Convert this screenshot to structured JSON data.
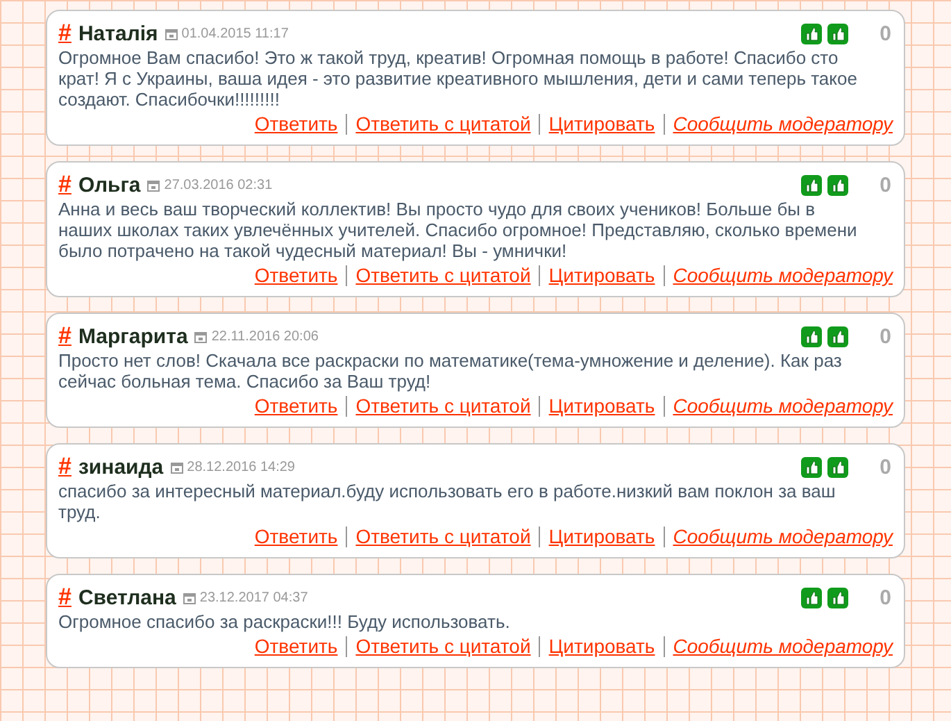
{
  "comments": [
    {
      "hash": "#",
      "author": "Наталія",
      "date": "01.04.2015 11:17",
      "rating": "0",
      "text": "Огромное Вам спасибо! Это ж такой труд, креатив! Огромная помощь в работе! Спасибо сто крат! Я с Украины, ваша идея - это развитие креативного мышления, дети и сами теперь такое создают. Спасибочки!!!!!!!!!",
      "actions": [
        "Ответить",
        "Ответить с цитатой",
        "Цитировать",
        "Сообщить модератору"
      ]
    },
    {
      "hash": "#",
      "author": "Ольга",
      "date": "27.03.2016 02:31",
      "rating": "0",
      "text": "Анна и весь ваш творческий коллектив! Вы просто чудо для своих учеников! Больше бы в наших школах таких увлечённых учителей. Спасибо огромное! Представляю, сколько времени было потрачено на такой чудесный материал! Вы - умнички!",
      "actions": [
        "Ответить",
        "Ответить с цитатой",
        "Цитировать",
        "Сообщить модератору"
      ]
    },
    {
      "hash": "#",
      "author": "Маргарита",
      "date": "22.11.2016 20:06",
      "rating": "0",
      "text": "Просто нет слов! Скачала все раскраски по математике(тема-умножение и деление). Как раз сейчас больная тема. Спасибо за Ваш труд!",
      "actions": [
        "Ответить",
        "Ответить с цитатой",
        "Цитировать",
        "Сообщить модератору"
      ]
    },
    {
      "hash": "#",
      "author": "зинаида",
      "date": "28.12.2016 14:29",
      "rating": "0",
      "text": "спасибо за интересный материал.буду использовать его в работе.низкий вам поклон за ваш труд.",
      "actions": [
        "Ответить",
        "Ответить с цитатой",
        "Цитировать",
        "Сообщить модератору"
      ]
    },
    {
      "hash": "#",
      "author": "Светлана",
      "date": "23.12.2017 04:37",
      "rating": "0",
      "text": "Огромное спасибо за раскраски!!! Буду использовать.",
      "actions": [
        "Ответить",
        "Ответить с цитатой",
        "Цитировать",
        "Сообщить модератору"
      ]
    }
  ]
}
